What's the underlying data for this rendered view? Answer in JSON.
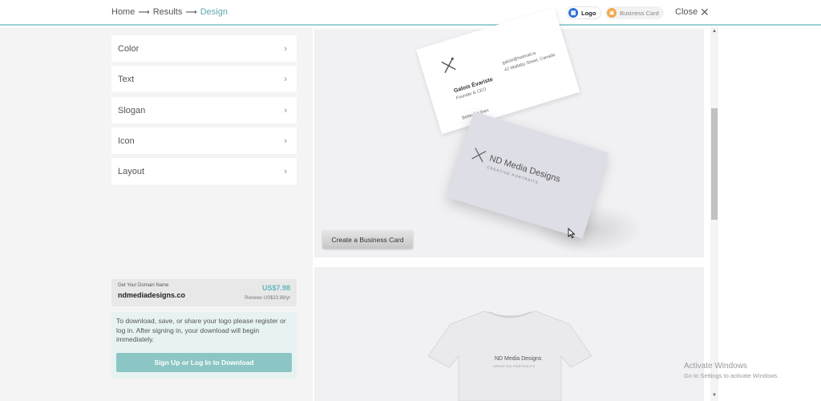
{
  "breadcrumb": {
    "home": "Home",
    "sep": "⟶",
    "results": "Results",
    "current": "Design"
  },
  "pills": {
    "logo": "Logo",
    "card": "Business Card"
  },
  "close_label": "Close",
  "menu": [
    {
      "label": "Color"
    },
    {
      "label": "Text"
    },
    {
      "label": "Slogan"
    },
    {
      "label": "Icon"
    },
    {
      "label": "Layout"
    }
  ],
  "domain": {
    "label": "Get Your Domain Name",
    "name": "ndmediadesigns.co",
    "price": "US$7.98",
    "renew": "Renews US$23.98/yr"
  },
  "download": {
    "text": "To download, save, or share your logo please register or log in. After signing in, your download will begin immediately.",
    "button": "Sign Up or Log In to Download"
  },
  "business_card": {
    "person": "Galois Évariste",
    "role": "Founder & CEO",
    "email": "galois@hotmail.io",
    "address": "42 Wallaby Street, Canada",
    "quote": "Believe it then",
    "brand": "ND Media Designs",
    "tagline": "CREATIVE PORTRAITS"
  },
  "create_button": "Create a Business Card",
  "shirt": {
    "brand": "ND Media Designs",
    "tagline": "CREATIVE PORTRAITS"
  },
  "watermark": {
    "title": "Activate Windows",
    "sub": "Go to Settings to activate Windows."
  },
  "colors": {
    "accent": "#5fa7b0",
    "button_teal": "#8cc6c4",
    "price": "#5fb7bf"
  }
}
